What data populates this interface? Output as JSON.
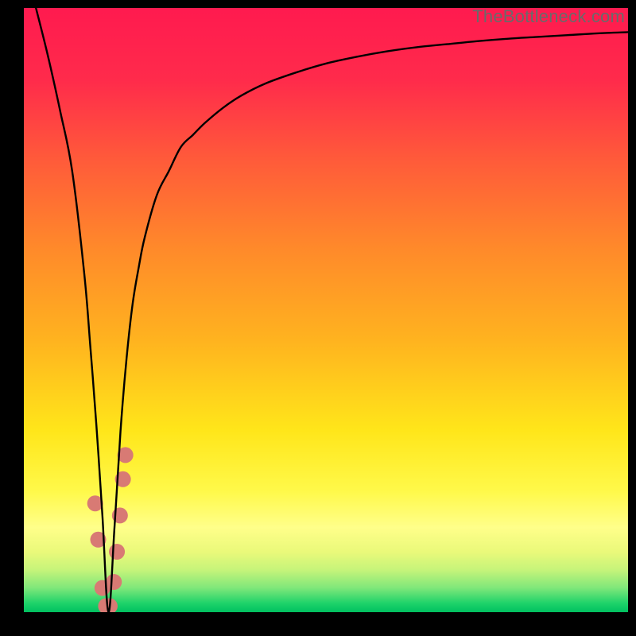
{
  "watermark": "TheBottleneck.com",
  "chart_data": {
    "type": "line",
    "title": "",
    "xlabel": "",
    "ylabel": "",
    "xlim": [
      0,
      100
    ],
    "ylim": [
      0,
      100
    ],
    "grid": false,
    "legend": false,
    "gradient_stops": [
      {
        "pos": 0.0,
        "color": "#ff1a4f"
      },
      {
        "pos": 0.12,
        "color": "#ff2b4b"
      },
      {
        "pos": 0.25,
        "color": "#ff5a3a"
      },
      {
        "pos": 0.4,
        "color": "#ff8a2a"
      },
      {
        "pos": 0.55,
        "color": "#ffb31f"
      },
      {
        "pos": 0.7,
        "color": "#ffe61a"
      },
      {
        "pos": 0.8,
        "color": "#fff94a"
      },
      {
        "pos": 0.86,
        "color": "#ffff8a"
      },
      {
        "pos": 0.9,
        "color": "#eaf97a"
      },
      {
        "pos": 0.93,
        "color": "#c6f47a"
      },
      {
        "pos": 0.96,
        "color": "#7fe77a"
      },
      {
        "pos": 0.985,
        "color": "#1fd36a"
      },
      {
        "pos": 1.0,
        "color": "#00c060"
      }
    ],
    "dip_x": 14,
    "series": [
      {
        "name": "curve",
        "color": "#000000",
        "x": [
          2,
          4,
          6,
          8,
          10,
          11,
          12,
          13,
          14,
          15,
          16,
          17,
          18,
          19,
          20,
          22,
          24,
          26,
          28,
          30,
          33,
          36,
          40,
          45,
          50,
          55,
          60,
          65,
          70,
          75,
          80,
          85,
          90,
          95,
          100
        ],
        "y": [
          100,
          92,
          83,
          73,
          56,
          44,
          31,
          16,
          0,
          14,
          30,
          42,
          51,
          57,
          62,
          69,
          73,
          77,
          79,
          81,
          83.5,
          85.5,
          87.5,
          89.3,
          90.8,
          91.9,
          92.8,
          93.5,
          94,
          94.5,
          94.9,
          95.2,
          95.5,
          95.8,
          96
        ]
      }
    ],
    "markers": {
      "name": "highlighted-points",
      "color": "#d87a74",
      "radius": 10,
      "points": [
        {
          "x": 11.8,
          "y": 18
        },
        {
          "x": 12.3,
          "y": 12
        },
        {
          "x": 13.0,
          "y": 4
        },
        {
          "x": 13.6,
          "y": 1
        },
        {
          "x": 14.2,
          "y": 1
        },
        {
          "x": 14.9,
          "y": 5
        },
        {
          "x": 15.4,
          "y": 10
        },
        {
          "x": 15.9,
          "y": 16
        },
        {
          "x": 16.4,
          "y": 22
        },
        {
          "x": 16.8,
          "y": 26
        }
      ]
    }
  }
}
